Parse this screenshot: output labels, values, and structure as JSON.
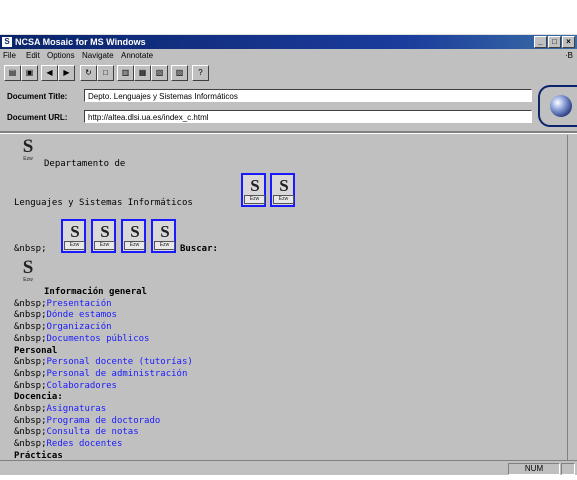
{
  "window": {
    "title": "NCSA Mosaic for MS Windows",
    "controls": [
      "_",
      "□",
      "×"
    ]
  },
  "menu": {
    "items": [
      "File",
      "Edit",
      "Options",
      "Navigate",
      "Annotate"
    ],
    "right_glyph": "·B"
  },
  "toolbar": {
    "buttons": [
      {
        "name": "open-icon",
        "glyph": "▤"
      },
      {
        "name": "save-icon",
        "glyph": "▣"
      },
      {
        "name": "back-icon",
        "glyph": "◀"
      },
      {
        "name": "forward-icon",
        "glyph": "▶"
      },
      {
        "name": "reload-icon",
        "glyph": "↻"
      },
      {
        "name": "home-icon",
        "glyph": "□"
      },
      {
        "name": "copy-icon",
        "glyph": "▥"
      },
      {
        "name": "paste-icon",
        "glyph": "▦"
      },
      {
        "name": "find-icon",
        "glyph": "▧"
      },
      {
        "name": "print-icon",
        "glyph": "▨"
      },
      {
        "name": "help-icon",
        "glyph": "?"
      }
    ]
  },
  "document": {
    "title_label": "Document Title:",
    "title_value": "Depto. Lenguajes y Sistemas Informáticos",
    "url_label": "Document URL:",
    "url_value": "http://altea.dlsi.ua.es/index_c.html"
  },
  "page": {
    "logo_caption": "Ezw",
    "dept_line1": "Departamento de",
    "dept_line2": "Lenguajes y Sistemas Informáticos",
    "nbsp": "&nbsp;",
    "buscar": "Buscar:",
    "sections": [
      {
        "heading": "Información general",
        "links": [
          "Presentación",
          "Dónde estamos",
          "Organización",
          "Documentos públicos"
        ]
      },
      {
        "heading": "Personal",
        "links": [
          "Personal docente (tutorías)",
          "Personal de administración",
          "Colaboradores"
        ]
      },
      {
        "heading": "Docencia:",
        "links": [
          "Asignaturas",
          "Programa de doctorado",
          "Consulta de notas",
          "Redes docentes"
        ]
      },
      {
        "heading": "Prácticas",
        "links": []
      }
    ]
  },
  "status": {
    "num": "NUM"
  },
  "colors": {
    "link": "#1a1aff",
    "titlebar": "#0a246a",
    "window": "#c0c0c0"
  }
}
